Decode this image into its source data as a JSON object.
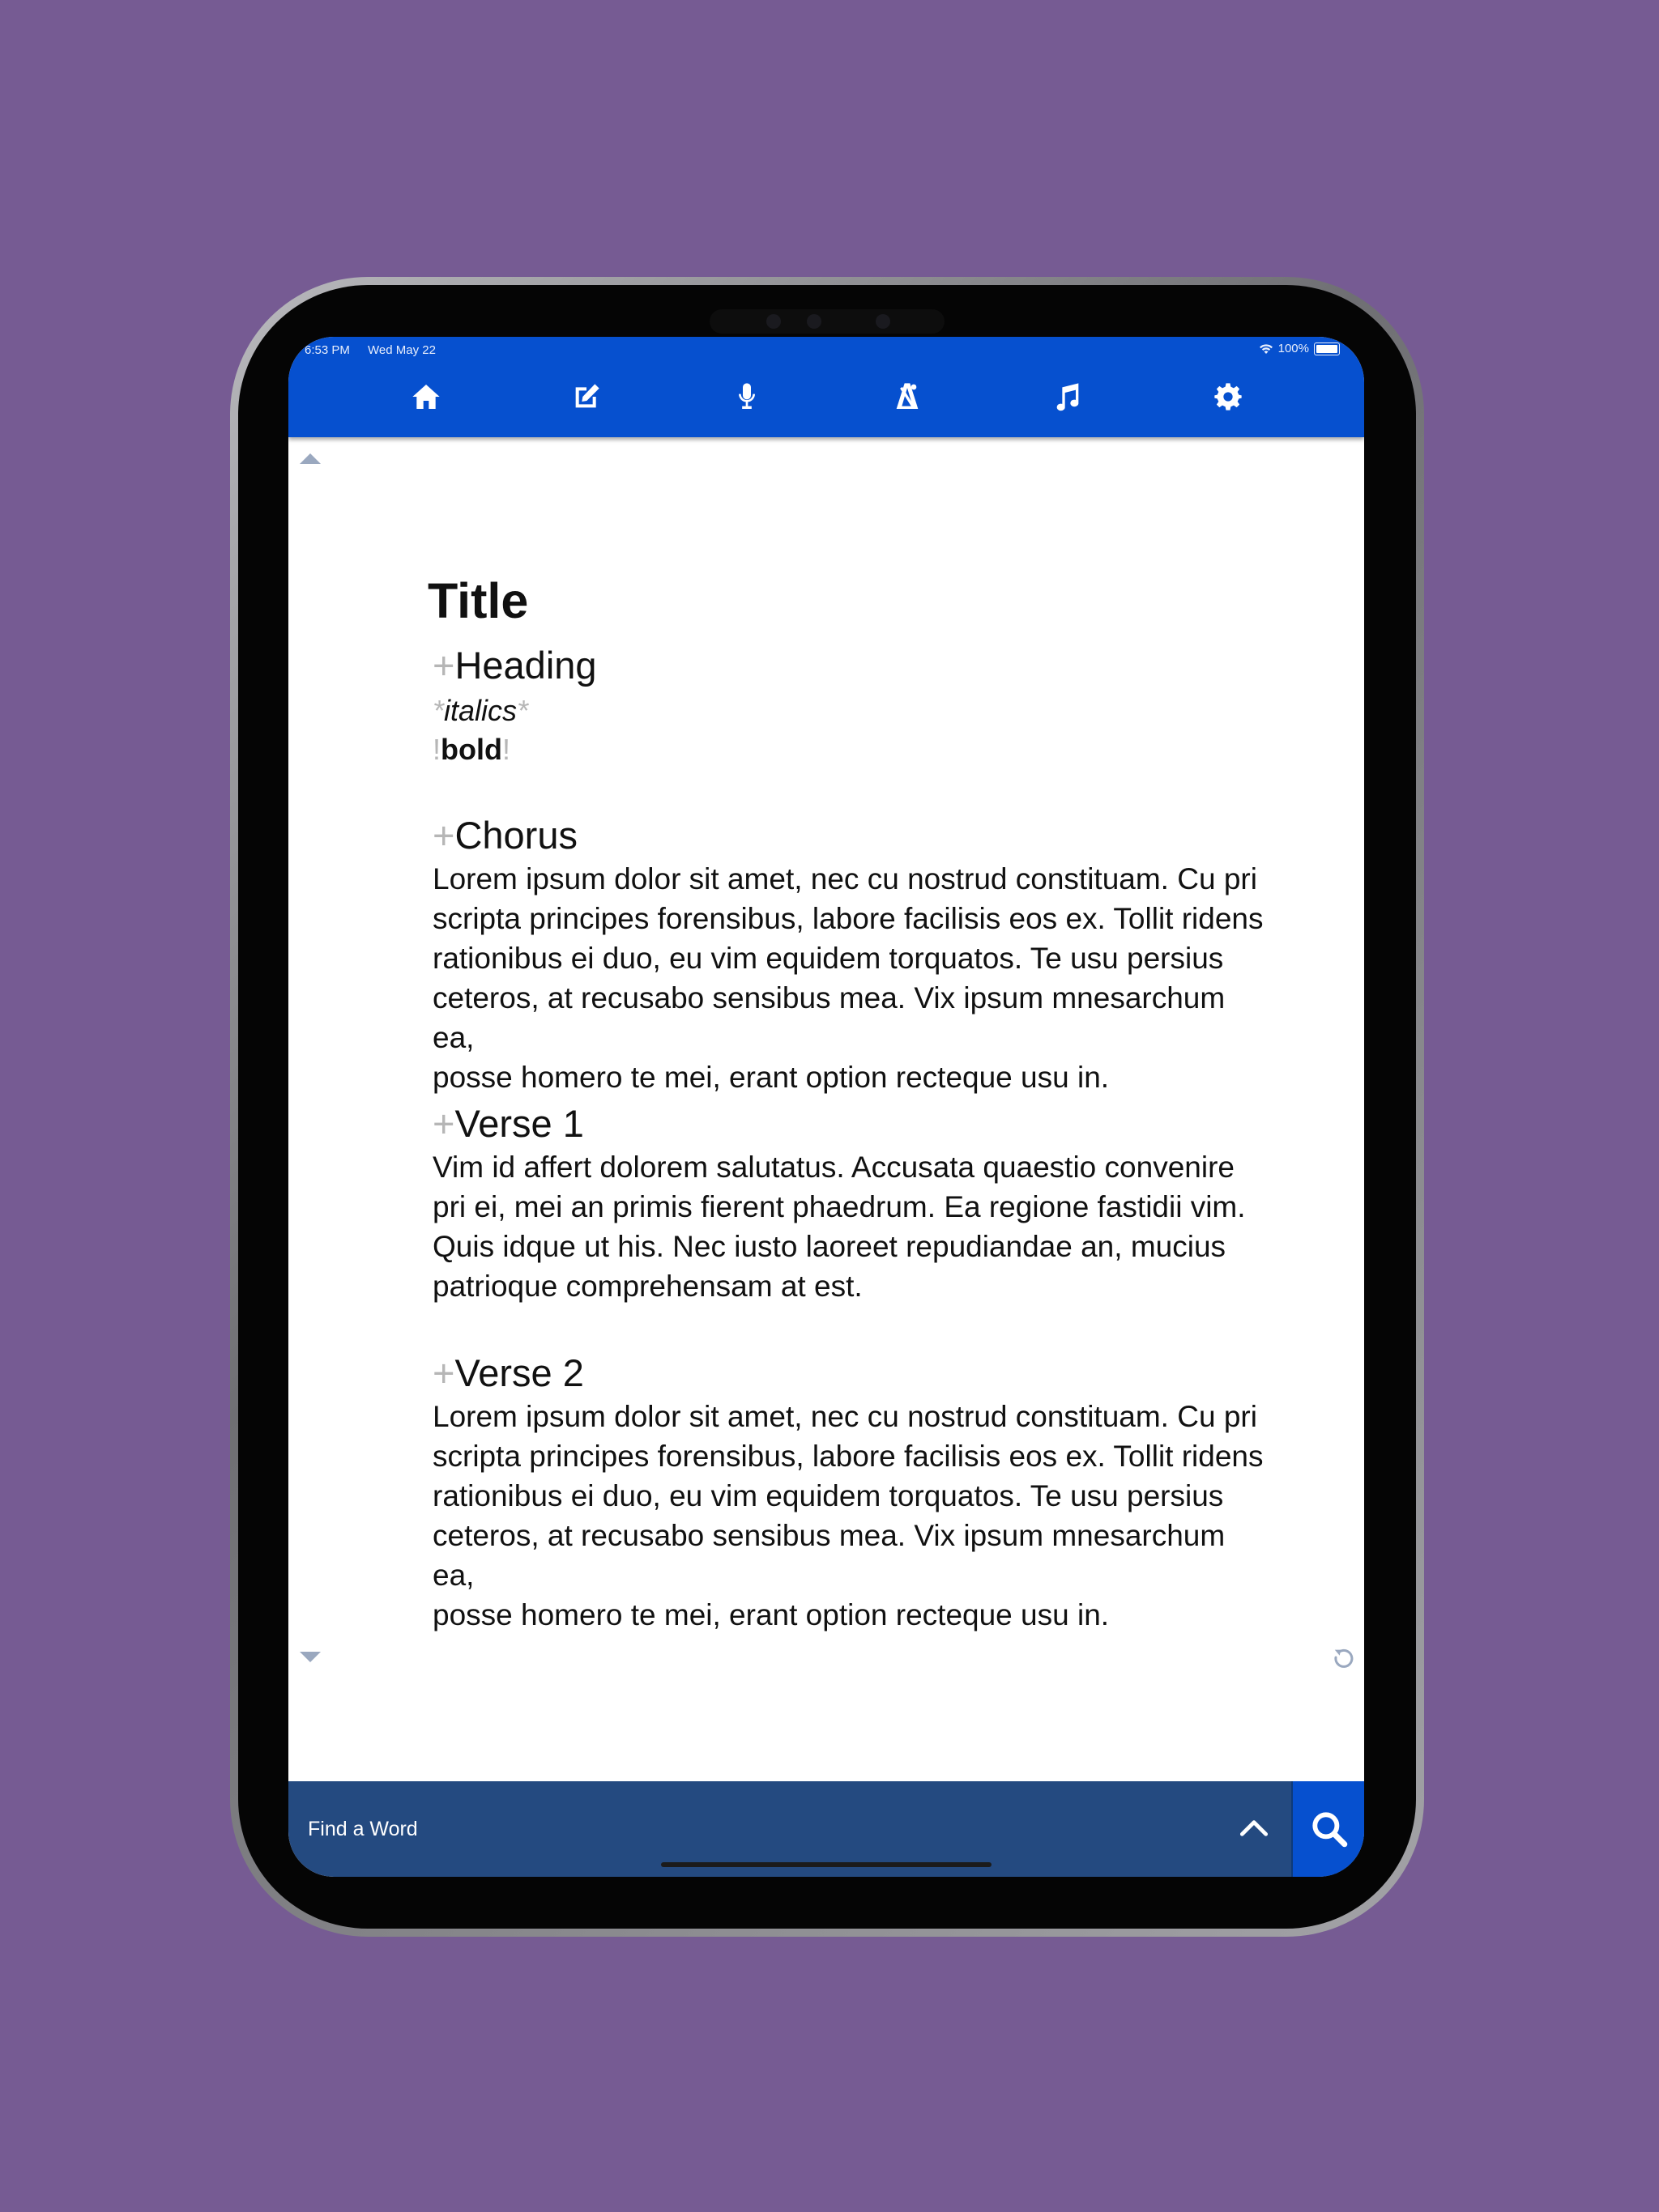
{
  "status_bar": {
    "time": "6:53 PM",
    "date": "Wed May 22",
    "battery": "100%"
  },
  "toolbar": {
    "icons": [
      "home-icon",
      "edit-icon",
      "microphone-icon",
      "metronome-icon",
      "music-note-icon",
      "gear-icon"
    ],
    "color": "#0650cf"
  },
  "document": {
    "title": "Title",
    "heading": {
      "marker": "+",
      "text": "Heading"
    },
    "italics": {
      "marker_open": "*",
      "text": "italics",
      "marker_close": "*"
    },
    "bold": {
      "marker_open": "!",
      "text": "bold",
      "marker_close": "!"
    },
    "sections": [
      {
        "marker": "+",
        "heading": "Chorus",
        "lines": [
          "Lorem ipsum dolor sit amet, nec cu nostrud constituam. Cu pri",
          "scripta principes forensibus, labore facilisis eos ex. Tollit ridens",
          "rationibus ei duo, eu vim equidem torquatos. Te usu persius",
          "ceteros, at recusabo sensibus mea. Vix ipsum mnesarchum ea,",
          "posse homero te mei, erant option recteque usu in."
        ]
      },
      {
        "marker": "+",
        "heading": "Verse 1",
        "lines": [
          "Vim id affert dolorem salutatus. Accusata quaestio convenire",
          "pri ei, mei an primis fierent phaedrum. Ea regione fastidii vim.",
          "Quis idque ut his. Nec iusto laoreet repudiandae an, mucius",
          "patrioque comprehensam at est."
        ]
      },
      {
        "marker": "+",
        "heading": "Verse 2",
        "lines": [
          "Lorem ipsum dolor sit amet, nec cu nostrud constituam. Cu pri",
          "scripta principes forensibus, labore facilisis eos ex. Tollit ridens",
          "rationibus ei duo, eu vim equidem torquatos. Te usu persius",
          "ceteros, at recusabo sensibus mea. Vix ipsum mnesarchum ea,",
          "posse homero te mei, erant option recteque usu in."
        ]
      }
    ]
  },
  "find_bar": {
    "placeholder": "Find a Word",
    "color": "#244a80"
  },
  "background_color": "#765b93"
}
